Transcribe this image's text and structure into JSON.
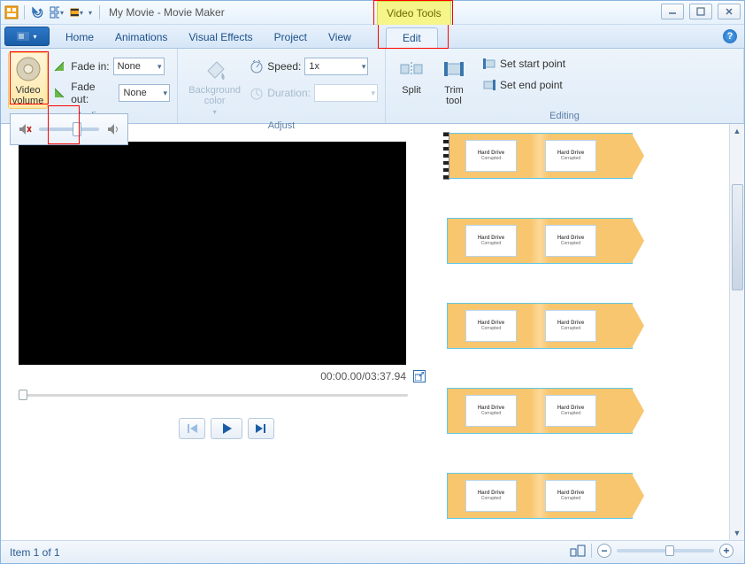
{
  "window": {
    "title": "My Movie - Movie Maker",
    "contextTab": "Video Tools"
  },
  "tabs": {
    "home": "Home",
    "animations": "Animations",
    "visualEffects": "Visual Effects",
    "project": "Project",
    "view": "View",
    "edit": "Edit"
  },
  "ribbon": {
    "audioGroup": {
      "videoVolume": "Video\nvolume",
      "fadeIn": "Fade in:",
      "fadeOut": "Fade out:",
      "fadeInValue": "None",
      "fadeOutValue": "None",
      "label": "Audio"
    },
    "adjustGroup": {
      "bgColor": "Background\ncolor",
      "speed": "Speed:",
      "speedValue": "1x",
      "duration": "Duration:",
      "durationValue": "",
      "label": "Adjust"
    },
    "editingGroup": {
      "split": "Split",
      "trim": "Trim\ntool",
      "setStart": "Set start point",
      "setEnd": "Set end point",
      "label": "Editing"
    }
  },
  "preview": {
    "time": "00:00.00/03:37.94"
  },
  "status": {
    "text": "Item 1 of 1"
  },
  "clip": {
    "title": "Hard Drive",
    "subtitle": "Corrupted"
  },
  "volumePopup": {
    "muteIcon": "speaker-mute-icon",
    "maxIcon": "speaker-icon"
  }
}
